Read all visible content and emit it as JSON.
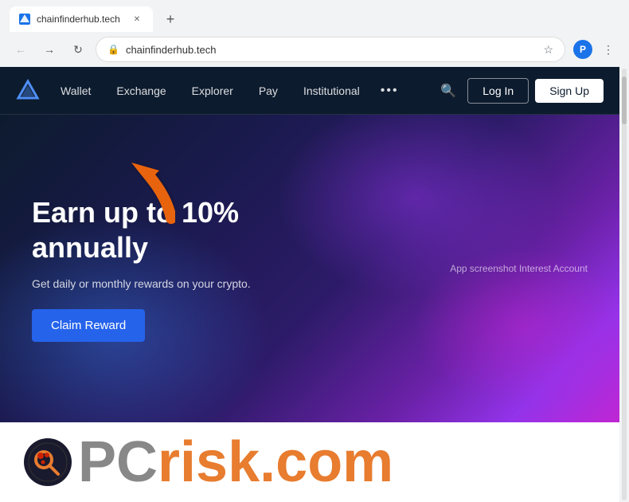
{
  "browser": {
    "tab": {
      "title": "chainfinderhub.tech",
      "favicon_label": "chain-icon"
    },
    "address": "chainfinderhub.tech",
    "new_tab_label": "+"
  },
  "site": {
    "nav": {
      "wallet": "Wallet",
      "exchange": "Exchange",
      "explorer": "Explorer",
      "pay": "Pay",
      "institutional": "Institutional"
    },
    "buttons": {
      "login": "Log In",
      "signup": "Sign Up"
    },
    "hero": {
      "title": "Earn up to 10% annually",
      "subtitle": "Get daily or monthly rewards on your crypto.",
      "cta": "Claim Reward",
      "app_screenshot": "App screenshot Interest Account"
    }
  },
  "watermark": {
    "pc": "PC",
    "risk": "risk",
    "com": ".com"
  }
}
